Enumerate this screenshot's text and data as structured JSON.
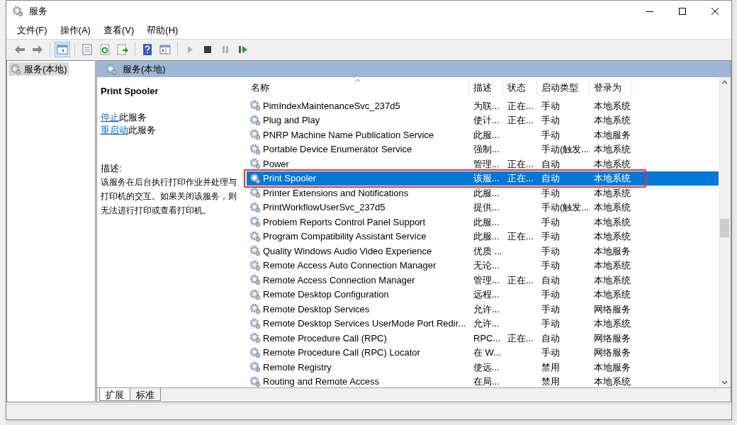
{
  "window": {
    "title": "服务"
  },
  "menu": [
    "文件(F)",
    "操作(A)",
    "查看(V)",
    "帮助(H)"
  ],
  "toolbar": [
    {
      "kind": "back",
      "disabled": false,
      "selected": false
    },
    {
      "kind": "forward",
      "disabled": false,
      "selected": false
    },
    {
      "kind": "tree",
      "disabled": false,
      "selected": true
    },
    {
      "kind": "properties",
      "disabled": false,
      "selected": false
    },
    {
      "kind": "refresh",
      "disabled": false,
      "selected": false
    },
    {
      "kind": "export",
      "disabled": false,
      "selected": false
    },
    {
      "kind": "help",
      "disabled": false,
      "selected": false
    },
    {
      "kind": "pane",
      "disabled": false,
      "selected": false
    },
    {
      "kind": "start",
      "disabled": true,
      "selected": false
    },
    {
      "kind": "stop",
      "disabled": false,
      "selected": false
    },
    {
      "kind": "pause",
      "disabled": true,
      "selected": false
    },
    {
      "kind": "resume",
      "disabled": false,
      "selected": false
    }
  ],
  "tree": {
    "items": [
      {
        "label": "服务(本地)",
        "selected": true
      }
    ]
  },
  "panel_header": "服务(本地)",
  "details": {
    "title": "Print Spooler",
    "actions": [
      {
        "link": "停止",
        "text": "此服务"
      },
      {
        "link": "重启动",
        "text": "此服务"
      }
    ],
    "description_label": "描述:",
    "description": "该服务在后台执行打印作业并处理与打印机的交互。如果关闭该服务，则无法进行打印或查看打印机。"
  },
  "table": {
    "columns": [
      "名称",
      "描述",
      "状态",
      "启动类型",
      "登录为"
    ],
    "rows": [
      {
        "cells": [
          "PimIndexMaintenanceSvc_237d5",
          "为联...",
          "正在...",
          "手动",
          "本地系统"
        ],
        "selected": false,
        "marked": false
      },
      {
        "cells": [
          "Plug and Play",
          "使计...",
          "正在...",
          "手动",
          "本地系统"
        ],
        "selected": false,
        "marked": false
      },
      {
        "cells": [
          "PNRP Machine Name Publication Service",
          "此服...",
          "",
          "手动",
          "本地服务"
        ],
        "selected": false,
        "marked": false
      },
      {
        "cells": [
          "Portable Device Enumerator Service",
          "强制...",
          "",
          "手动(触发...",
          "本地系统"
        ],
        "selected": false,
        "marked": false
      },
      {
        "cells": [
          "Power",
          "管理...",
          "正在...",
          "自动",
          "本地系统"
        ],
        "selected": false,
        "marked": false
      },
      {
        "cells": [
          "Print Spooler",
          "该服...",
          "正在...",
          "自动",
          "本地系统"
        ],
        "selected": true,
        "marked": true
      },
      {
        "cells": [
          "Printer Extensions and Notifications",
          "此服...",
          "",
          "手动",
          "本地系统"
        ],
        "selected": false,
        "marked": false
      },
      {
        "cells": [
          "PrintWorkflowUserSvc_237d5",
          "提供...",
          "",
          "手动(触发...",
          "本地系统"
        ],
        "selected": false,
        "marked": false
      },
      {
        "cells": [
          "Problem Reports Control Panel Support",
          "此服...",
          "",
          "手动",
          "本地系统"
        ],
        "selected": false,
        "marked": false
      },
      {
        "cells": [
          "Program Compatibility Assistant Service",
          "此服...",
          "正在...",
          "手动",
          "本地系统"
        ],
        "selected": false,
        "marked": false
      },
      {
        "cells": [
          "Quality Windows Audio Video Experience",
          "优质 ...",
          "",
          "手动",
          "本地服务"
        ],
        "selected": false,
        "marked": false
      },
      {
        "cells": [
          "Remote Access Auto Connection Manager",
          "无论...",
          "",
          "手动",
          "本地系统"
        ],
        "selected": false,
        "marked": false
      },
      {
        "cells": [
          "Remote Access Connection Manager",
          "管理...",
          "正在...",
          "自动",
          "本地系统"
        ],
        "selected": false,
        "marked": false
      },
      {
        "cells": [
          "Remote Desktop Configuration",
          "远程...",
          "",
          "手动",
          "本地系统"
        ],
        "selected": false,
        "marked": false
      },
      {
        "cells": [
          "Remote Desktop Services",
          "允许...",
          "",
          "手动",
          "网络服务"
        ],
        "selected": false,
        "marked": false
      },
      {
        "cells": [
          "Remote Desktop Services UserMode Port Redir...",
          "允许...",
          "",
          "手动",
          "本地系统"
        ],
        "selected": false,
        "marked": false
      },
      {
        "cells": [
          "Remote Procedure Call (RPC)",
          "RPC...",
          "正在...",
          "自动",
          "网络服务"
        ],
        "selected": false,
        "marked": false
      },
      {
        "cells": [
          "Remote Procedure Call (RPC) Locator",
          "在 W...",
          "",
          "手动",
          "网络服务"
        ],
        "selected": false,
        "marked": false
      },
      {
        "cells": [
          "Remote Registry",
          "使远...",
          "",
          "禁用",
          "本地服务"
        ],
        "selected": false,
        "marked": false
      },
      {
        "cells": [
          "Routing and Remote Access",
          "在局...",
          "",
          "禁用",
          "本地系统"
        ],
        "selected": false,
        "marked": false
      }
    ]
  },
  "view_tabs": [
    {
      "label": "扩展",
      "selected": true
    },
    {
      "label": "标准",
      "selected": false
    }
  ]
}
